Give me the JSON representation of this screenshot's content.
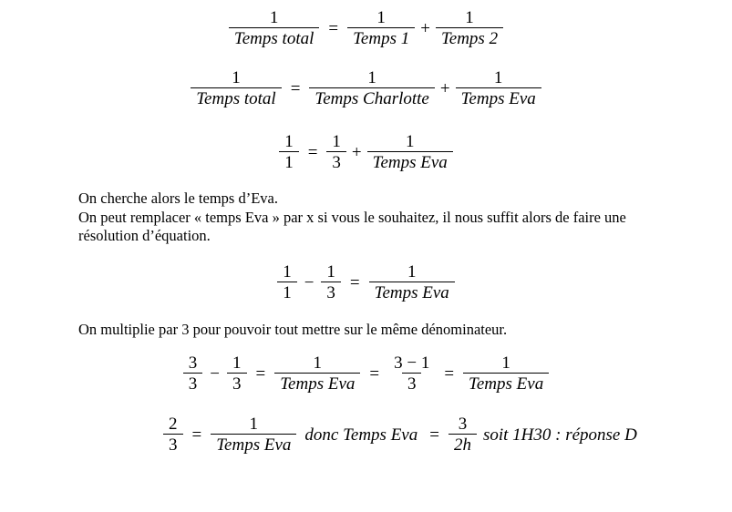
{
  "document": {
    "title": "Résolution d'équation - Temps Eva",
    "language": "fr",
    "background_color": "#ffffff",
    "text_color": "#000000"
  },
  "equations": [
    {
      "id": "eq1",
      "name": "equation-temps-total-generic",
      "parts": {
        "lhs_num": "1",
        "lhs_den": "Temps total",
        "equals": "=",
        "t1_num": "1",
        "t1_den": "Temps 1",
        "plus": "+",
        "t2_num": "1",
        "t2_den": "Temps 2"
      }
    },
    {
      "id": "eq2",
      "name": "equation-temps-total-named",
      "parts": {
        "lhs_num": "1",
        "lhs_den": "Temps total",
        "equals": "=",
        "t1_num": "1",
        "t1_den": "Temps Charlotte",
        "plus": "+",
        "t2_num": "1",
        "t2_den": "Temps Eva"
      }
    },
    {
      "id": "eq3",
      "name": "equation-substituted-values",
      "parts": {
        "lhs_num": "1",
        "lhs_den": "1",
        "equals": "=",
        "t1_num": "1",
        "t1_den": "3",
        "plus": "+",
        "t2_num": "1",
        "t2_den": "Temps Eva"
      }
    },
    {
      "id": "eq4",
      "name": "equation-isolate-temps-eva",
      "parts": {
        "a_num": "1",
        "a_den": "1",
        "minus": "−",
        "b_num": "1",
        "b_den": "3",
        "equals": "=",
        "r_num": "1",
        "r_den": "Temps Eva"
      }
    },
    {
      "id": "eq5",
      "name": "equation-common-denominator",
      "parts": {
        "a_num": "3",
        "a_den": "3",
        "minus": "−",
        "b_num": "1",
        "b_den": "3",
        "equals1": "=",
        "c_num": "1",
        "c_den": "Temps Eva",
        "equals2": "=",
        "d_num": "3 − 1",
        "d_den": "3",
        "equals3": "=",
        "e_num": "1",
        "e_den": "Temps Eva"
      }
    },
    {
      "id": "eq6",
      "name": "equation-final-result",
      "parts": {
        "a_num": "2",
        "a_den": "3",
        "equals1": "=",
        "b_num": "1",
        "b_den": "Temps Eva",
        "donc": "donc Temps Eva",
        "equals2": "=",
        "c_num": "3",
        "c_den": "2h",
        "soit": "soit 1H30 : réponse D"
      }
    }
  ],
  "paragraphs": [
    {
      "id": "para1",
      "name": "paragraph-cherche-temps-eva",
      "lines": [
        "On cherche alors le temps d’Eva.",
        "On peut remplacer « temps Eva » par x si vous le souhaitez, il nous suffit alors de faire une résolution d’équation."
      ]
    },
    {
      "id": "para2",
      "name": "paragraph-multiplie-par-3",
      "lines": [
        "On multiplie par 3 pour pouvoir tout mettre sur le même dénominateur."
      ]
    }
  ]
}
